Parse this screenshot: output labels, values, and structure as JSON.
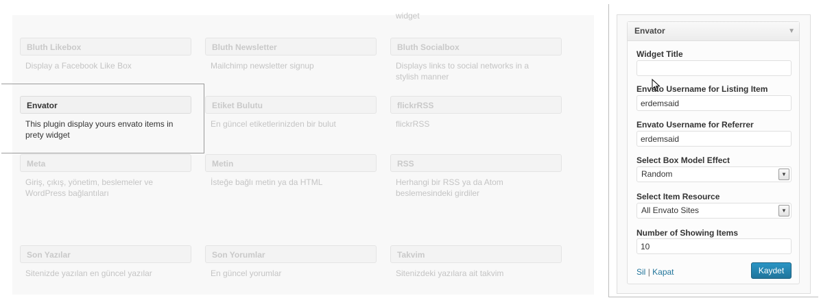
{
  "available_widgets": {
    "top_fragment": "widget",
    "items": [
      {
        "title": "Bluth Likebox",
        "desc": "Display a Facebook Like Box"
      },
      {
        "title": "Bluth Newsletter",
        "desc": "Mailchimp newsletter signup"
      },
      {
        "title": "Bluth Socialbox",
        "desc": "Displays links to social networks in a stylish manner"
      },
      {
        "title": "Envator",
        "desc": "This plugin display yours envato items in prety widget"
      },
      {
        "title": "Etiket Bulutu",
        "desc": "En güncel etiketlerinizden bir bulut"
      },
      {
        "title": "flickrRSS",
        "desc": "flickrRSS"
      },
      {
        "title": "Meta",
        "desc": "Giriş, çıkış, yönetim, beslemeler ve WordPress bağlantıları"
      },
      {
        "title": "Metin",
        "desc": "İsteğe bağlı metin ya da HTML"
      },
      {
        "title": "RSS",
        "desc": "Herhangi bir RSS ya da Atom beslemesindeki girdiler"
      },
      {
        "title": "Son Yazılar",
        "desc": "Sitenizde yazılan en güncel yazılar"
      },
      {
        "title": "Son Yorumlar",
        "desc": "En güncel yorumlar"
      },
      {
        "title": "Takvim",
        "desc": "Sitenizdeki yazılara ait takvim"
      }
    ]
  },
  "widget_form": {
    "title": "Envator",
    "toggle_icon": "triangle-down-icon",
    "fields": {
      "widget_title": {
        "label": "Widget Title",
        "value": ""
      },
      "listing_username": {
        "label": "Envato Username for Listing Item",
        "value": "erdemsaid"
      },
      "referrer_username": {
        "label": "Envato Username for Referrer",
        "value": "erdemsaid"
      },
      "box_effect": {
        "label": "Select Box Model Effect",
        "value": "Random"
      },
      "item_resource": {
        "label": "Select Item Resource",
        "value": "All Envato Sites"
      },
      "showing_items": {
        "label": "Number of Showing Items",
        "value": "10"
      }
    },
    "delete_link": "Sil",
    "separator": "|",
    "close_link": "Kapat",
    "save_label": "Kaydet"
  }
}
